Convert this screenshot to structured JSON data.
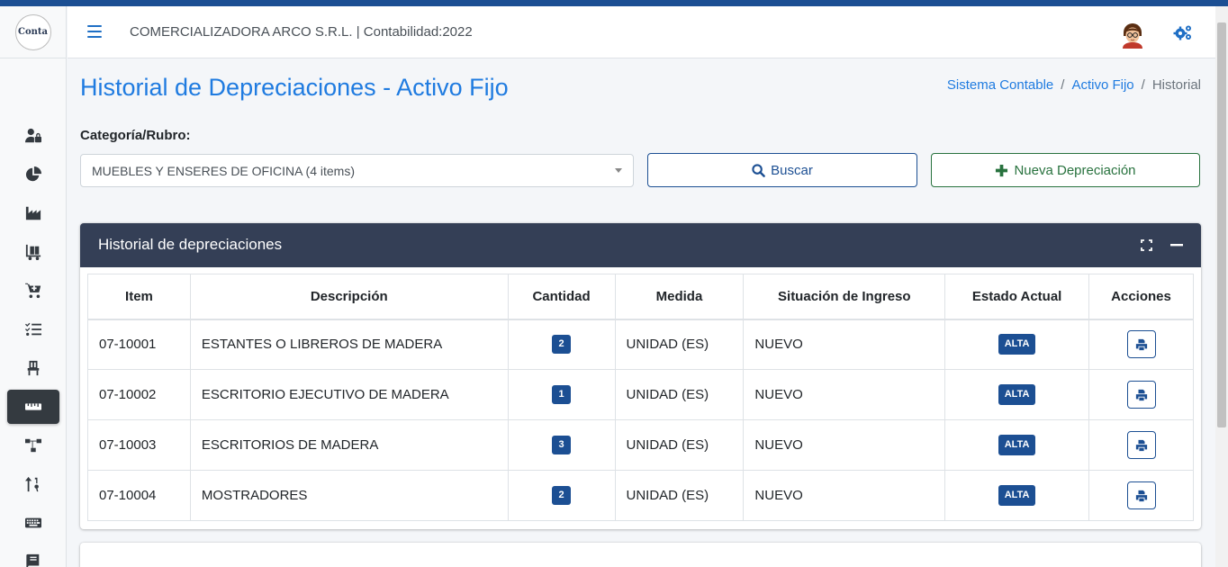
{
  "brand": {
    "logo_text": "Conta"
  },
  "navbar": {
    "title": "COMERCIALIZADORA ARCO S.R.L. | Contabilidad:2022"
  },
  "page": {
    "title": "Historial de Depreciaciones - Activo Fijo",
    "breadcrumb": [
      "Sistema Contable",
      "Activo Fijo",
      "Historial"
    ]
  },
  "filter": {
    "label": "Categoría/Rubro:",
    "selected": "MUEBLES Y ENSERES DE OFICINA (4 items)",
    "buscar_label": "Buscar",
    "nueva_label": "Nueva Depreciación"
  },
  "sidebar": {
    "icons": [
      "user-lock-icon",
      "chart-pie-icon",
      "industry-icon",
      "dolly-icon",
      "cart-plus-icon",
      "tasks-icon",
      "chair-icon",
      "ruler-icon",
      "sitemap-icon",
      "sort-numeric-icon",
      "keyboard-icon",
      "book-icon"
    ],
    "active_index": 7
  },
  "card": {
    "title": "Historial de depreciaciones",
    "columns": [
      "Item",
      "Descripción",
      "Cantidad",
      "Medida",
      "Situación de Ingreso",
      "Estado Actual",
      "Acciones"
    ],
    "rows": [
      {
        "item": "07-10001",
        "descripcion": "ESTANTES O LIBREROS DE MADERA",
        "cantidad": "2",
        "medida": "UNIDAD (ES)",
        "situacion": "NUEVO",
        "estado": "ALTA"
      },
      {
        "item": "07-10002",
        "descripcion": "ESCRITORIO EJECUTIVO DE MADERA",
        "cantidad": "1",
        "medida": "UNIDAD (ES)",
        "situacion": "NUEVO",
        "estado": "ALTA"
      },
      {
        "item": "07-10003",
        "descripcion": "ESCRITORIOS DE MADERA",
        "cantidad": "3",
        "medida": "UNIDAD (ES)",
        "situacion": "NUEVO",
        "estado": "ALTA"
      },
      {
        "item": "07-10004",
        "descripcion": "MOSTRADORES",
        "cantidad": "2",
        "medida": "UNIDAD (ES)",
        "situacion": "NUEVO",
        "estado": "ALTA"
      }
    ]
  },
  "colors": {
    "primary": "#1f7be0",
    "dark_blue": "#1c4f93",
    "header_bg": "#343f56",
    "green": "#28723e"
  }
}
